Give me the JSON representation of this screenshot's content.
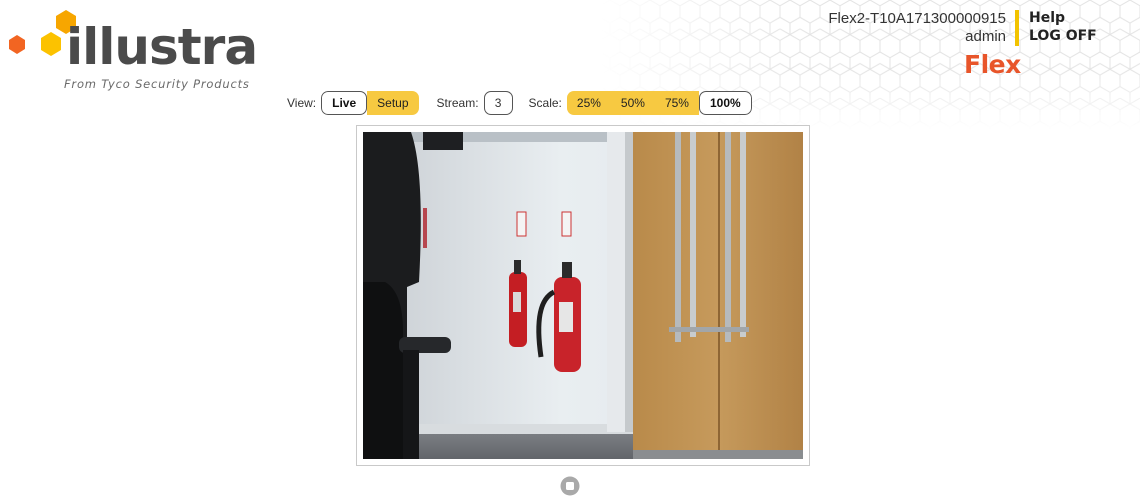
{
  "header": {
    "logo": {
      "wordmark": "illustra",
      "tagline": "From Tyco Security Products",
      "dot_colors": [
        "#f7a600",
        "#f26522",
        "#fcc200"
      ]
    },
    "device_name": "Flex2-T10A171300000915",
    "user_name": "admin",
    "help_label": "Help",
    "logoff_label": "LOG OFF",
    "product_name": "Flex",
    "colors": {
      "accent": "#f2c300",
      "product": "#e8552a"
    }
  },
  "toolbar": {
    "view_label": "View:",
    "view_options": [
      "Live",
      "Setup"
    ],
    "view_selected": "Live",
    "stream_label": "Stream:",
    "stream_value": "3",
    "scale_label": "Scale:",
    "scale_options": [
      "25%",
      "50%",
      "75%",
      "100%"
    ],
    "scale_selected": "100%",
    "button_color": "#f7c941"
  },
  "video": {
    "scene": "camera-live-feed",
    "stop_icon": "stop-icon"
  }
}
